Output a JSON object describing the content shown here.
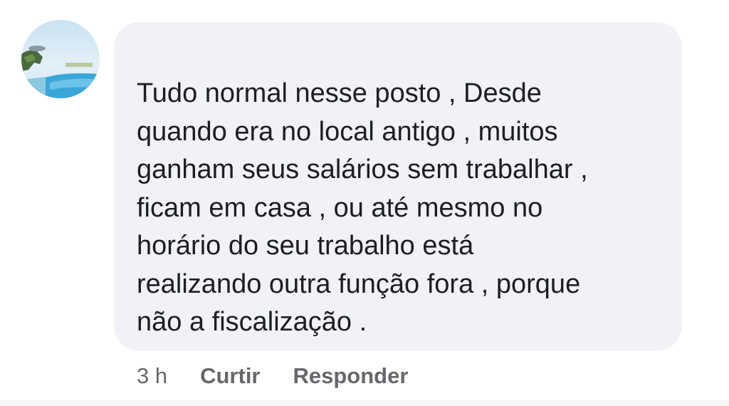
{
  "comment": {
    "text": "Tudo normal  nesse posto ,  Desde\nquando era no local antigo , muitos\nganham seus salários sem trabalhar ,\nficam em casa , ou até mesmo no\nhorário do seu trabalho está\nrealizando outra função fora , porque\nnão a fiscalização .",
    "timestamp": "3 h",
    "like_label": "Curtir",
    "reply_label": "Responder"
  },
  "colors": {
    "bubble_background": "#f0f2f5",
    "text": "#1c1e21",
    "meta_text": "#65676b"
  },
  "icons": {
    "avatar": "profile-avatar-photo"
  }
}
